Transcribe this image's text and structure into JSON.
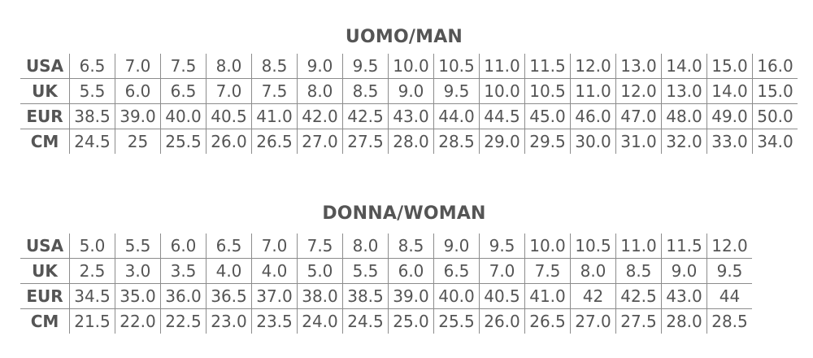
{
  "man": {
    "title": "UOMO/MAN",
    "rows": [
      {
        "label": "USA",
        "values": [
          "6.5",
          "7.0",
          "7.5",
          "8.0",
          "8.5",
          "9.0",
          "9.5",
          "10.0",
          "10.5",
          "11.0",
          "11.5",
          "12.0",
          "13.0",
          "14.0",
          "15.0",
          "16.0"
        ]
      },
      {
        "label": "UK",
        "values": [
          "5.5",
          "6.0",
          "6.5",
          "7.0",
          "7.5",
          "8.0",
          "8.5",
          "9.0",
          "9.5",
          "10.0",
          "10.5",
          "11.0",
          "12.0",
          "13.0",
          "14.0",
          "15.0"
        ]
      },
      {
        "label": "EUR",
        "values": [
          "38.5",
          "39.0",
          "40.0",
          "40.5",
          "41.0",
          "42.0",
          "42.5",
          "43.0",
          "44.0",
          "44.5",
          "45.0",
          "46.0",
          "47.0",
          "48.0",
          "49.0",
          "50.0"
        ]
      },
      {
        "label": "CM",
        "values": [
          "24.5",
          "25",
          "25.5",
          "26.0",
          "26.5",
          "27.0",
          "27.5",
          "28.0",
          "28.5",
          "29.0",
          "29.5",
          "30.0",
          "31.0",
          "32.0",
          "33.0",
          "34.0"
        ]
      }
    ]
  },
  "woman": {
    "title": "DONNA/WOMAN",
    "rows": [
      {
        "label": "USA",
        "values": [
          "5.0",
          "5.5",
          "6.0",
          "6.5",
          "7.0",
          "7.5",
          "8.0",
          "8.5",
          "9.0",
          "9.5",
          "10.0",
          "10.5",
          "11.0",
          "11.5",
          "12.0"
        ]
      },
      {
        "label": "UK",
        "values": [
          "2.5",
          "3.0",
          "3.5",
          "4.0",
          "4.0",
          "5.0",
          "5.5",
          "6.0",
          "6.5",
          "7.0",
          "7.5",
          "8.0",
          "8.5",
          "9.0",
          "9.5"
        ]
      },
      {
        "label": "EUR",
        "values": [
          "34.5",
          "35.0",
          "36.0",
          "36.5",
          "37.0",
          "38.0",
          "38.5",
          "39.0",
          "40.0",
          "40.5",
          "41.0",
          "42",
          "42.5",
          "43.0",
          "44"
        ]
      },
      {
        "label": "CM",
        "values": [
          "21.5",
          "22.0",
          "22.5",
          "23.0",
          "23.5",
          "24.0",
          "24.5",
          "25.0",
          "25.5",
          "26.0",
          "26.5",
          "27.0",
          "27.5",
          "28.0",
          "28.5"
        ]
      }
    ]
  }
}
